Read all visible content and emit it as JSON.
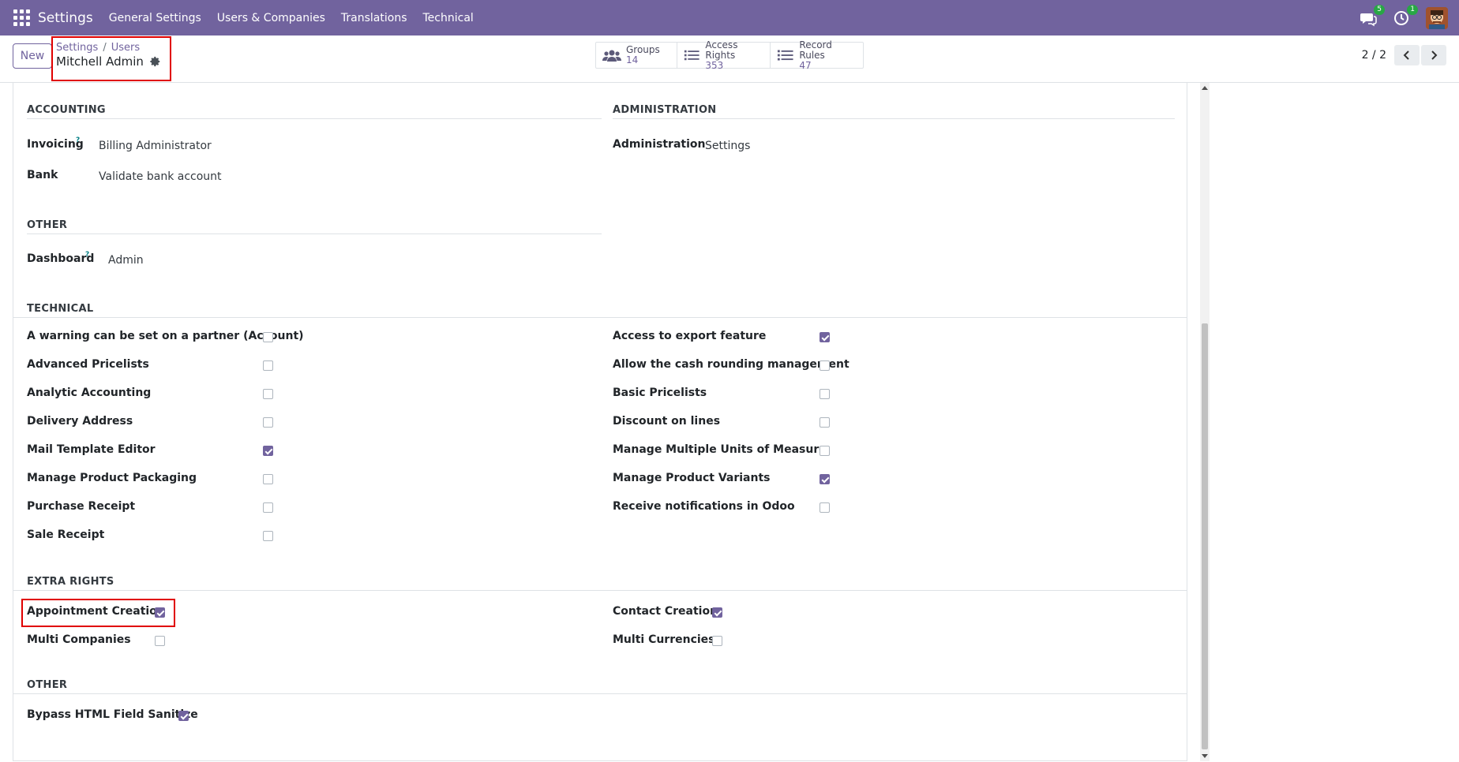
{
  "navbar": {
    "brand": "Settings",
    "menu": [
      "General Settings",
      "Users & Companies",
      "Translations",
      "Technical"
    ],
    "messages_badge": "5",
    "activities_badge": "1"
  },
  "control": {
    "new_label": "New",
    "breadcrumb": {
      "parent": "Settings",
      "child": "Users"
    },
    "record_name": "Mitchell Admin",
    "smart_buttons": [
      {
        "label": "Groups",
        "count": "14",
        "icon": "users-icon"
      },
      {
        "label": "Access Rights",
        "count": "353",
        "icon": "list-icon"
      },
      {
        "label": "Record Rules",
        "count": "47",
        "icon": "list-icon"
      }
    ],
    "pager": "2 / 2"
  },
  "accounting": {
    "title": "ACCOUNTING",
    "invoicing_label": "Invoicing",
    "invoicing_value": "Billing Administrator",
    "bank_label": "Bank",
    "bank_value": "Validate bank account"
  },
  "administration": {
    "title": "ADMINISTRATION",
    "label": "Administration",
    "value": "Settings"
  },
  "other1": {
    "title": "OTHER",
    "dashboard_label": "Dashboard",
    "dashboard_value": "Admin"
  },
  "technical": {
    "title": "TECHNICAL",
    "left": [
      {
        "label": "A warning can be set on a partner (Account)",
        "checked": false
      },
      {
        "label": "Advanced Pricelists",
        "checked": false
      },
      {
        "label": "Analytic Accounting",
        "checked": false
      },
      {
        "label": "Delivery Address",
        "checked": false
      },
      {
        "label": "Mail Template Editor",
        "checked": true
      },
      {
        "label": "Manage Product Packaging",
        "checked": false
      },
      {
        "label": "Purchase Receipt",
        "checked": false
      },
      {
        "label": "Sale Receipt",
        "checked": false
      }
    ],
    "right": [
      {
        "label": "Access to export feature",
        "checked": true
      },
      {
        "label": "Allow the cash rounding management",
        "checked": false
      },
      {
        "label": "Basic Pricelists",
        "checked": false
      },
      {
        "label": "Discount on lines",
        "checked": false
      },
      {
        "label": "Manage Multiple Units of Measure",
        "checked": false
      },
      {
        "label": "Manage Product Variants",
        "checked": true
      },
      {
        "label": "Receive notifications in Odoo",
        "checked": false
      }
    ]
  },
  "extra_rights": {
    "title": "EXTRA RIGHTS",
    "left": [
      {
        "label": "Appointment Creation",
        "checked": true
      },
      {
        "label": "Multi Companies",
        "checked": false
      }
    ],
    "right": [
      {
        "label": "Contact Creation",
        "checked": true
      },
      {
        "label": "Multi Currencies",
        "checked": false
      }
    ]
  },
  "other2": {
    "title": "OTHER",
    "items": [
      {
        "label": "Bypass HTML Field Sanitize",
        "checked": true
      }
    ]
  },
  "help_mark": "?"
}
